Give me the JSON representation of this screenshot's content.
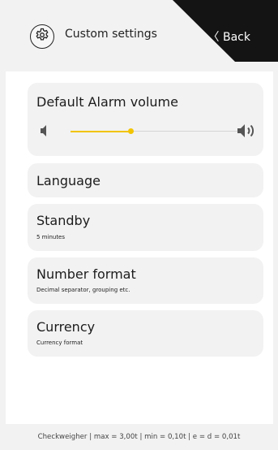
{
  "header": {
    "title": "Custom settings",
    "back_label": "〈 Back",
    "gear_icon": "gear-icon"
  },
  "volume": {
    "title": "Default Alarm volume",
    "level": 0.35,
    "accent_color": "#f2c400",
    "low_icon": "speaker-low-icon",
    "high_icon": "speaker-high-icon"
  },
  "menu": {
    "language": {
      "title": "Language"
    },
    "standby": {
      "title": "Standby",
      "subtitle": "5 minutes"
    },
    "number_format": {
      "title": "Number format",
      "subtitle": "Decimal separator, grouping etc."
    },
    "currency": {
      "title": "Currency",
      "subtitle": "Currency format"
    }
  },
  "footer": {
    "status": "Checkweigher | max = 3,00t | min = 0,10t | e = d = 0,01t"
  }
}
